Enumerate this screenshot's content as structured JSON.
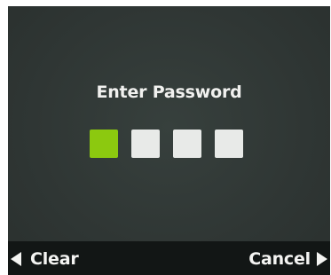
{
  "dialog": {
    "title": "Enter Password"
  },
  "pin": {
    "length": 4,
    "active_index": 0,
    "active_color": "#8cc90f",
    "inactive_color": "#e8eae8"
  },
  "softkeys": {
    "left_label": "Clear",
    "left_icon": "triangle-left-icon",
    "right_label": "Cancel",
    "right_icon": "triangle-right-icon"
  }
}
